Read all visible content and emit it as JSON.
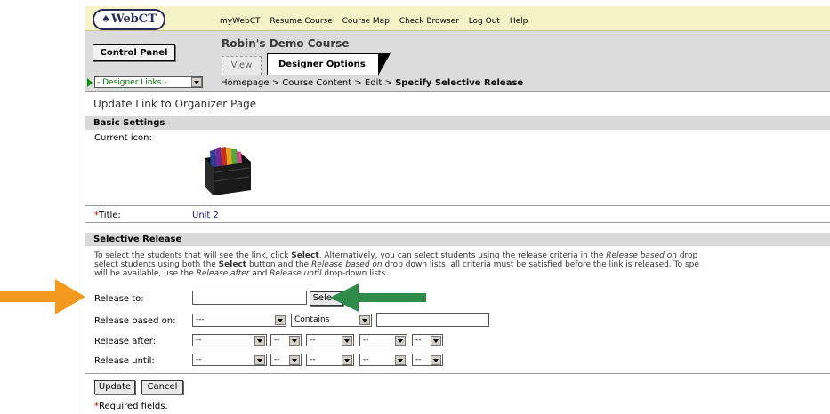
{
  "header": {
    "logo_text": "WebCT",
    "nav": [
      "myWebCT",
      "Resume Course",
      "Course Map",
      "Check Browser",
      "Log Out",
      "Help"
    ]
  },
  "course": {
    "control_panel_label": "Control Panel",
    "title": "Robin's Demo Course",
    "tabs": {
      "view": "View",
      "designer": "Designer Options"
    }
  },
  "crumbbar": {
    "designer_links": "- Designer Links -",
    "crumbs": [
      "Homepage",
      "Course Content",
      "Edit"
    ],
    "separator": ">",
    "current": "Specify Selective Release"
  },
  "page": {
    "title": "Update Link to Organizer Page",
    "basic_settings": "Basic Settings",
    "current_icon_label": "Current icon:",
    "title_label": "Title:",
    "title_value": "Unit 2",
    "required_marker": "*",
    "selective_release": "Selective Release",
    "instructions": {
      "line1_a": "To select the students that will see the link, click ",
      "line1_b": "Select",
      "line1_c": ". Alternatively, you can select students using the release criteria in the ",
      "line1_d": "Release based on",
      "line1_e": " drop",
      "line2_a": "select students using both the ",
      "line2_b": "Select",
      "line2_c": " button and the ",
      "line2_d": "Release based on",
      "line2_e": " drop down lists, all criteria must be satisfied before the link is released. To spe",
      "line3_a": "will be available, use the ",
      "line3_b": "Release after",
      "line3_c": " and ",
      "line3_d": "Release until",
      "line3_e": " drop-down lists."
    },
    "release_to_label": "Release to:",
    "release_to_value": "",
    "select_button": "Select",
    "release_based_on_label": "Release based on:",
    "release_based_on_value": "---",
    "contains_value": "Contains",
    "criteria_value": "",
    "release_after_label": "Release after:",
    "release_until_label": "Release until:",
    "date_placeholder": "--",
    "update_button": "Update",
    "cancel_button": "Cancel",
    "required_note": "Required fields."
  },
  "colors": {
    "callout_orange": "#f39a1e",
    "callout_green": "#2e8b4a",
    "topbar": "#f6f3c9",
    "section_gray": "#d9d9d9"
  },
  "icons": [
    "webct-logo-figure-icon",
    "folder-organizer-icon",
    "designer-links-arrow-icon",
    "dropdown-arrow-icon",
    "orange-arrow-icon",
    "green-arrow-icon"
  ]
}
